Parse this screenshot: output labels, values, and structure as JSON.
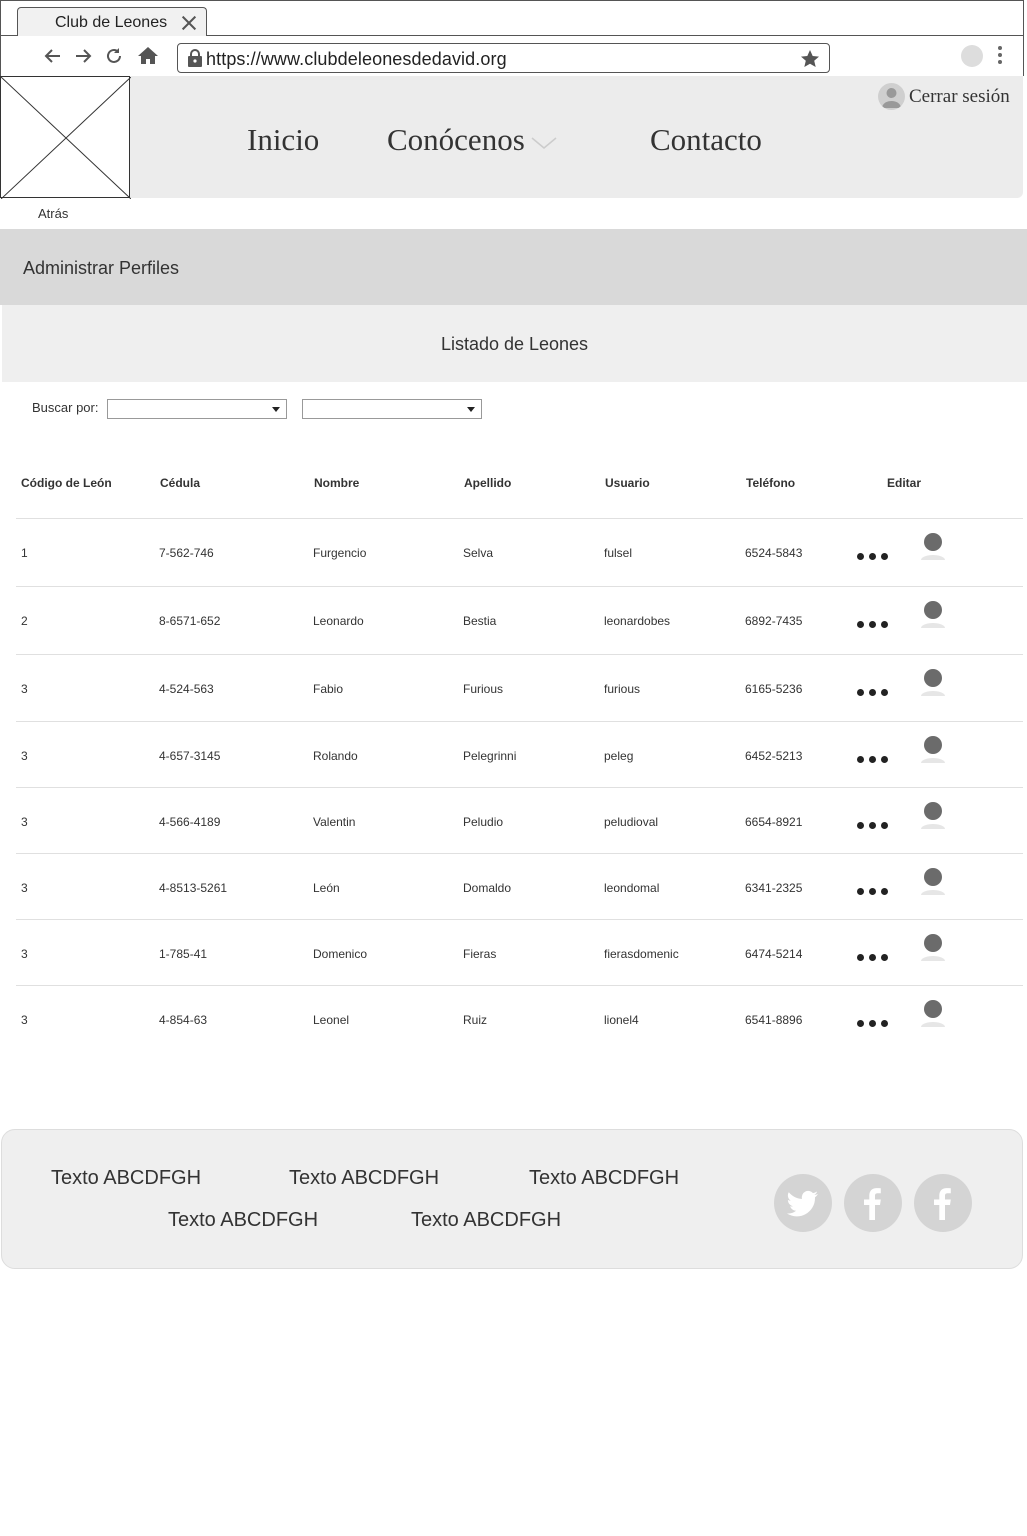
{
  "browser": {
    "tab_title": "Club de Leones",
    "url": "https://www.clubdeleonesdedavid.org"
  },
  "header": {
    "nav": [
      {
        "label": "Inicio"
      },
      {
        "label": "Conócenos"
      },
      {
        "label": "Contacto"
      }
    ],
    "logout_label": "Cerrar sesión"
  },
  "back_label": "Atrás",
  "page_title": "Administrar Perfiles",
  "section_title": "Listado de Leones",
  "filter": {
    "label": "Buscar por:",
    "select1_value": "",
    "select2_value": ""
  },
  "table": {
    "columns": [
      "Código de León",
      "Cédula",
      "Nombre",
      "Apellido",
      "Usuario",
      "Teléfono",
      "Editar"
    ],
    "rows": [
      {
        "codigo": "1",
        "cedula": "7-562-746",
        "nombre": "Furgencio",
        "apellido": "Selva",
        "usuario": "fulsel",
        "telefono": "6524-5843"
      },
      {
        "codigo": "2",
        "cedula": "8-6571-652",
        "nombre": "Leonardo",
        "apellido": "Bestia",
        "usuario": "leonardobes",
        "telefono": "6892-7435"
      },
      {
        "codigo": "3",
        "cedula": "4-524-563",
        "nombre": "Fabio",
        "apellido": "Furious",
        "usuario": "furious",
        "telefono": "6165-5236"
      },
      {
        "codigo": "3",
        "cedula": "4-657-3145",
        "nombre": "Rolando",
        "apellido": "Pelegrinni",
        "usuario": "peleg",
        "telefono": "6452-5213"
      },
      {
        "codigo": "3",
        "cedula": "4-566-4189",
        "nombre": "Valentin",
        "apellido": "Peludio",
        "usuario": "peludioval",
        "telefono": "6654-8921"
      },
      {
        "codigo": "3",
        "cedula": "4-8513-5261",
        "nombre": "León",
        "apellido": "Domaldo",
        "usuario": "leondomal",
        "telefono": "6341-2325"
      },
      {
        "codigo": "3",
        "cedula": "1-785-41",
        "nombre": "Domenico",
        "apellido": "Fieras",
        "usuario": "fierasdomenic",
        "telefono": "6474-5214"
      },
      {
        "codigo": "3",
        "cedula": "4-854-63",
        "nombre": "Leonel",
        "apellido": "Ruiz",
        "usuario": "lionel4",
        "telefono": "6541-8896"
      }
    ]
  },
  "footer": {
    "links": [
      "Texto ABCDFGH",
      "Texto ABCDFGH",
      "Texto ABCDFGH",
      "Texto ABCDFGH",
      "Texto ABCDFGH"
    ],
    "social": [
      "twitter-icon",
      "facebook-icon",
      "facebook-icon"
    ]
  },
  "colors": {
    "header_bg": "#ececec",
    "band_bg": "#d9d9d9",
    "section_bg": "#efefef",
    "social_bg": "#d4d4d4"
  }
}
